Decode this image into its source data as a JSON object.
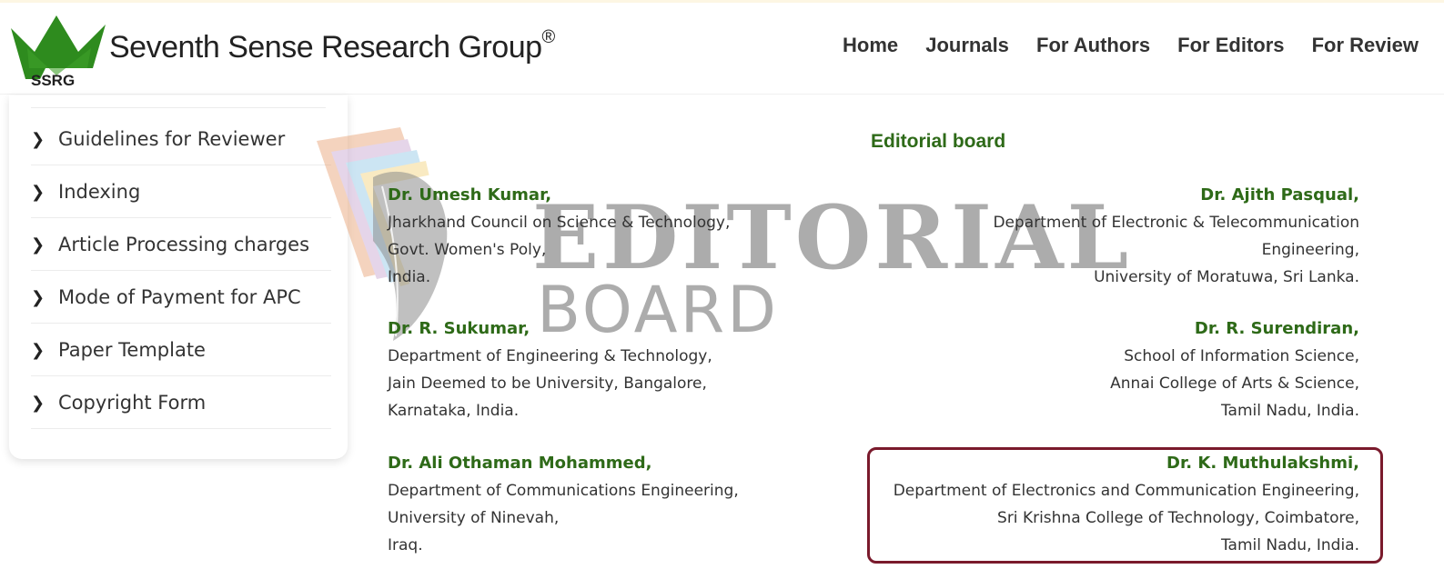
{
  "brand": {
    "name": "Seventh Sense Research Group",
    "registered": "®",
    "abbr": "SSRG",
    "colors": {
      "crown": "#2e8b1e",
      "accent_green": "#2e6a18",
      "highlight": "#7a1a2c"
    }
  },
  "nav": [
    "Home",
    "Journals",
    "For Authors",
    "For Editors",
    "For Review"
  ],
  "sidebar": {
    "items": [
      {
        "label": "Guidelines for Reviewer",
        "icon": "chevron-right-icon"
      },
      {
        "label": "Indexing",
        "icon": "chevron-right-icon"
      },
      {
        "label": "Article Processing charges",
        "icon": "chevron-right-icon"
      },
      {
        "label": "Mode of Payment for APC",
        "icon": "chevron-right-icon"
      },
      {
        "label": "Paper Template",
        "icon": "chevron-right-icon"
      },
      {
        "label": "Copyright Form",
        "icon": "chevron-right-icon"
      }
    ]
  },
  "watermark": {
    "title": "EDITORIAL",
    "subtitle": "BOARD"
  },
  "editorial": {
    "title": "Editorial board",
    "left": [
      {
        "name": "Dr. Umesh Kumar,",
        "lines": [
          "Jharkhand Council on Science & Technology,",
          "Govt. Women's Poly,",
          "India."
        ]
      },
      {
        "name": "Dr. R. Sukumar,",
        "lines": [
          "Department of Engineering & Technology,",
          "Jain Deemed to be University, Bangalore,",
          "Karnataka, India."
        ]
      },
      {
        "name": "Dr. Ali Othaman Mohammed,",
        "lines": [
          "Department of Communications Engineering,",
          "University of Ninevah,",
          "Iraq."
        ]
      }
    ],
    "right": [
      {
        "name": "Dr. Ajith Pasqual,",
        "lines": [
          "Department of Electronic & Telecommunication",
          "Engineering,",
          "University of Moratuwa, Sri Lanka."
        ]
      },
      {
        "name": "Dr. R. Surendiran,",
        "lines": [
          "School of Information Science,",
          "Annai College of Arts & Science,",
          "Tamil Nadu, India."
        ]
      },
      {
        "name": "Dr. K. Muthulakshmi,",
        "lines": [
          "Department of Electronics and Communication Engineering,",
          "Sri Krishna College of Technology, Coimbatore,",
          "Tamil Nadu, India."
        ]
      }
    ]
  }
}
